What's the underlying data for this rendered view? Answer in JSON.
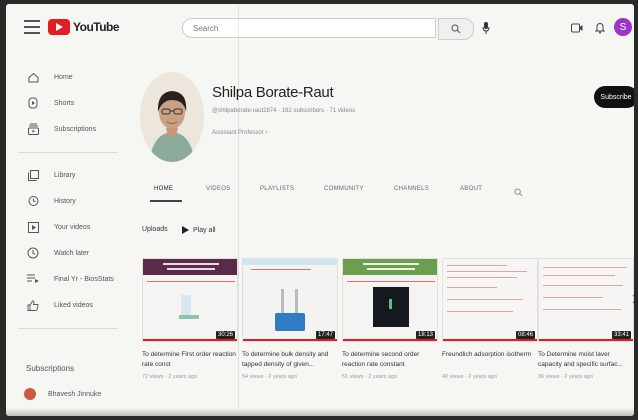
{
  "header": {
    "logo_text": "YouTube",
    "search_placeholder": "Search",
    "avatar_letter": "S"
  },
  "sidebar": {
    "items": [
      {
        "label": "Home",
        "icon": "home-icon"
      },
      {
        "label": "Shorts",
        "icon": "shorts-icon"
      },
      {
        "label": "Subscriptions",
        "icon": "subscriptions-icon"
      },
      {
        "label": "Library",
        "icon": "library-icon"
      },
      {
        "label": "History",
        "icon": "history-icon"
      },
      {
        "label": "Your videos",
        "icon": "your-videos-icon"
      },
      {
        "label": "Watch later",
        "icon": "watch-later-icon"
      },
      {
        "label": "Final Yr - BiosStats",
        "icon": "playlist-icon"
      },
      {
        "label": "Liked videos",
        "icon": "like-icon"
      }
    ],
    "subscriptions_heading": "Subscriptions",
    "subscriptions": [
      {
        "label": "Bhavesh Jinnuke",
        "color": "#c95b43"
      }
    ]
  },
  "channel": {
    "name": "Shilpa Borate-Raut",
    "meta": "@shilpaborate-raut2874 · 162 subscribers · 71 videos",
    "about": "Assistant Professor  ›",
    "subscribe_label": "Subscribe"
  },
  "tabs": [
    "HOME",
    "VIDEOS",
    "PLAYLISTS",
    "COMMUNITY",
    "CHANNELS",
    "ABOUT"
  ],
  "section": {
    "uploads_label": "Uploads",
    "play_all_label": "Play all"
  },
  "videos": [
    {
      "title": "To determine First order reaction rate const",
      "duration": "30:26",
      "meta": "72 views · 2 years ago"
    },
    {
      "title": "To determine bulk density and tapped density of given...",
      "duration": "17:47",
      "meta": "54 views · 2 years ago"
    },
    {
      "title": "To determine second order reaction rate constant",
      "duration": "18:13",
      "meta": "51 views · 2 years ago"
    },
    {
      "title": "Freundlich adsorption isotherm",
      "duration": "08:46",
      "meta": "40 views · 2 years ago"
    },
    {
      "title": "To Determine moist laver capacity and specific surfac...",
      "duration": "33:41",
      "meta": "36 views · 2 years ago"
    }
  ],
  "colors": {
    "brand_red": "#e31b23",
    "avatar_purple": "#9b36c6"
  }
}
